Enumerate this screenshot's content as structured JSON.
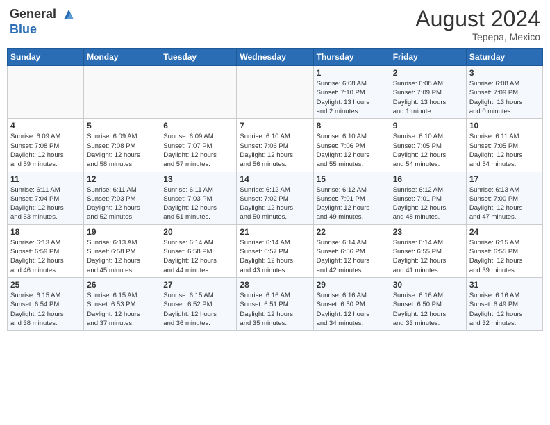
{
  "header": {
    "logo_line1": "General",
    "logo_line2": "Blue",
    "month_year": "August 2024",
    "location": "Tepepa, Mexico"
  },
  "days_of_week": [
    "Sunday",
    "Monday",
    "Tuesday",
    "Wednesday",
    "Thursday",
    "Friday",
    "Saturday"
  ],
  "weeks": [
    [
      {
        "day": "",
        "info": ""
      },
      {
        "day": "",
        "info": ""
      },
      {
        "day": "",
        "info": ""
      },
      {
        "day": "",
        "info": ""
      },
      {
        "day": "1",
        "info": "Sunrise: 6:08 AM\nSunset: 7:10 PM\nDaylight: 13 hours\nand 2 minutes."
      },
      {
        "day": "2",
        "info": "Sunrise: 6:08 AM\nSunset: 7:09 PM\nDaylight: 13 hours\nand 1 minute."
      },
      {
        "day": "3",
        "info": "Sunrise: 6:08 AM\nSunset: 7:09 PM\nDaylight: 13 hours\nand 0 minutes."
      }
    ],
    [
      {
        "day": "4",
        "info": "Sunrise: 6:09 AM\nSunset: 7:08 PM\nDaylight: 12 hours\nand 59 minutes."
      },
      {
        "day": "5",
        "info": "Sunrise: 6:09 AM\nSunset: 7:08 PM\nDaylight: 12 hours\nand 58 minutes."
      },
      {
        "day": "6",
        "info": "Sunrise: 6:09 AM\nSunset: 7:07 PM\nDaylight: 12 hours\nand 57 minutes."
      },
      {
        "day": "7",
        "info": "Sunrise: 6:10 AM\nSunset: 7:06 PM\nDaylight: 12 hours\nand 56 minutes."
      },
      {
        "day": "8",
        "info": "Sunrise: 6:10 AM\nSunset: 7:06 PM\nDaylight: 12 hours\nand 55 minutes."
      },
      {
        "day": "9",
        "info": "Sunrise: 6:10 AM\nSunset: 7:05 PM\nDaylight: 12 hours\nand 54 minutes."
      },
      {
        "day": "10",
        "info": "Sunrise: 6:11 AM\nSunset: 7:05 PM\nDaylight: 12 hours\nand 54 minutes."
      }
    ],
    [
      {
        "day": "11",
        "info": "Sunrise: 6:11 AM\nSunset: 7:04 PM\nDaylight: 12 hours\nand 53 minutes."
      },
      {
        "day": "12",
        "info": "Sunrise: 6:11 AM\nSunset: 7:03 PM\nDaylight: 12 hours\nand 52 minutes."
      },
      {
        "day": "13",
        "info": "Sunrise: 6:11 AM\nSunset: 7:03 PM\nDaylight: 12 hours\nand 51 minutes."
      },
      {
        "day": "14",
        "info": "Sunrise: 6:12 AM\nSunset: 7:02 PM\nDaylight: 12 hours\nand 50 minutes."
      },
      {
        "day": "15",
        "info": "Sunrise: 6:12 AM\nSunset: 7:01 PM\nDaylight: 12 hours\nand 49 minutes."
      },
      {
        "day": "16",
        "info": "Sunrise: 6:12 AM\nSunset: 7:01 PM\nDaylight: 12 hours\nand 48 minutes."
      },
      {
        "day": "17",
        "info": "Sunrise: 6:13 AM\nSunset: 7:00 PM\nDaylight: 12 hours\nand 47 minutes."
      }
    ],
    [
      {
        "day": "18",
        "info": "Sunrise: 6:13 AM\nSunset: 6:59 PM\nDaylight: 12 hours\nand 46 minutes."
      },
      {
        "day": "19",
        "info": "Sunrise: 6:13 AM\nSunset: 6:58 PM\nDaylight: 12 hours\nand 45 minutes."
      },
      {
        "day": "20",
        "info": "Sunrise: 6:14 AM\nSunset: 6:58 PM\nDaylight: 12 hours\nand 44 minutes."
      },
      {
        "day": "21",
        "info": "Sunrise: 6:14 AM\nSunset: 6:57 PM\nDaylight: 12 hours\nand 43 minutes."
      },
      {
        "day": "22",
        "info": "Sunrise: 6:14 AM\nSunset: 6:56 PM\nDaylight: 12 hours\nand 42 minutes."
      },
      {
        "day": "23",
        "info": "Sunrise: 6:14 AM\nSunset: 6:55 PM\nDaylight: 12 hours\nand 41 minutes."
      },
      {
        "day": "24",
        "info": "Sunrise: 6:15 AM\nSunset: 6:55 PM\nDaylight: 12 hours\nand 39 minutes."
      }
    ],
    [
      {
        "day": "25",
        "info": "Sunrise: 6:15 AM\nSunset: 6:54 PM\nDaylight: 12 hours\nand 38 minutes."
      },
      {
        "day": "26",
        "info": "Sunrise: 6:15 AM\nSunset: 6:53 PM\nDaylight: 12 hours\nand 37 minutes."
      },
      {
        "day": "27",
        "info": "Sunrise: 6:15 AM\nSunset: 6:52 PM\nDaylight: 12 hours\nand 36 minutes."
      },
      {
        "day": "28",
        "info": "Sunrise: 6:16 AM\nSunset: 6:51 PM\nDaylight: 12 hours\nand 35 minutes."
      },
      {
        "day": "29",
        "info": "Sunrise: 6:16 AM\nSunset: 6:50 PM\nDaylight: 12 hours\nand 34 minutes."
      },
      {
        "day": "30",
        "info": "Sunrise: 6:16 AM\nSunset: 6:50 PM\nDaylight: 12 hours\nand 33 minutes."
      },
      {
        "day": "31",
        "info": "Sunrise: 6:16 AM\nSunset: 6:49 PM\nDaylight: 12 hours\nand 32 minutes."
      }
    ]
  ]
}
